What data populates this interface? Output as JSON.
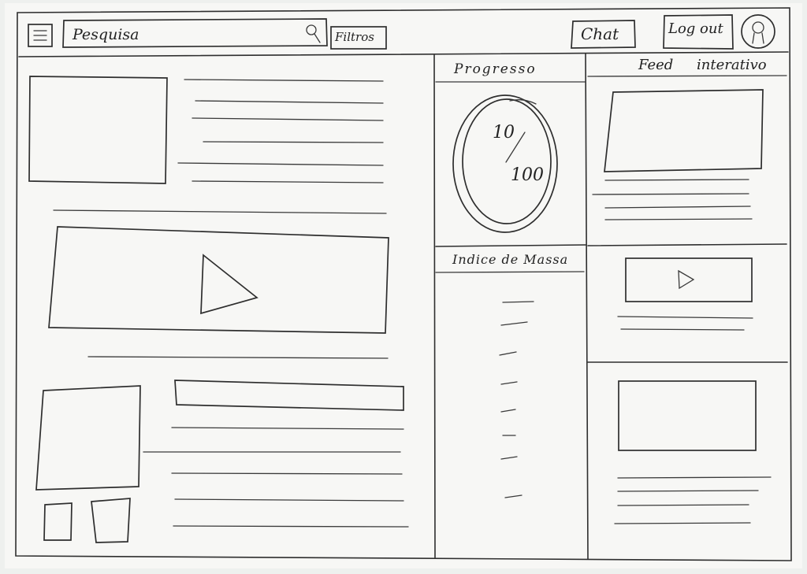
{
  "header": {
    "search_placeholder": "Pesquisa",
    "filters_label": "Filtros",
    "chat_label": "Chat",
    "logout_label": "Log out"
  },
  "icons": {
    "menu": "hamburger-menu-icon",
    "search": "search-icon",
    "avatar": "user-avatar-icon",
    "play": "play-icon"
  },
  "progress": {
    "title": "Progresso",
    "current": "10",
    "total": "100",
    "fraction": 0.1
  },
  "mass_index": {
    "title": "Indice de Massa"
  },
  "feed": {
    "title": "Feed interativo"
  }
}
